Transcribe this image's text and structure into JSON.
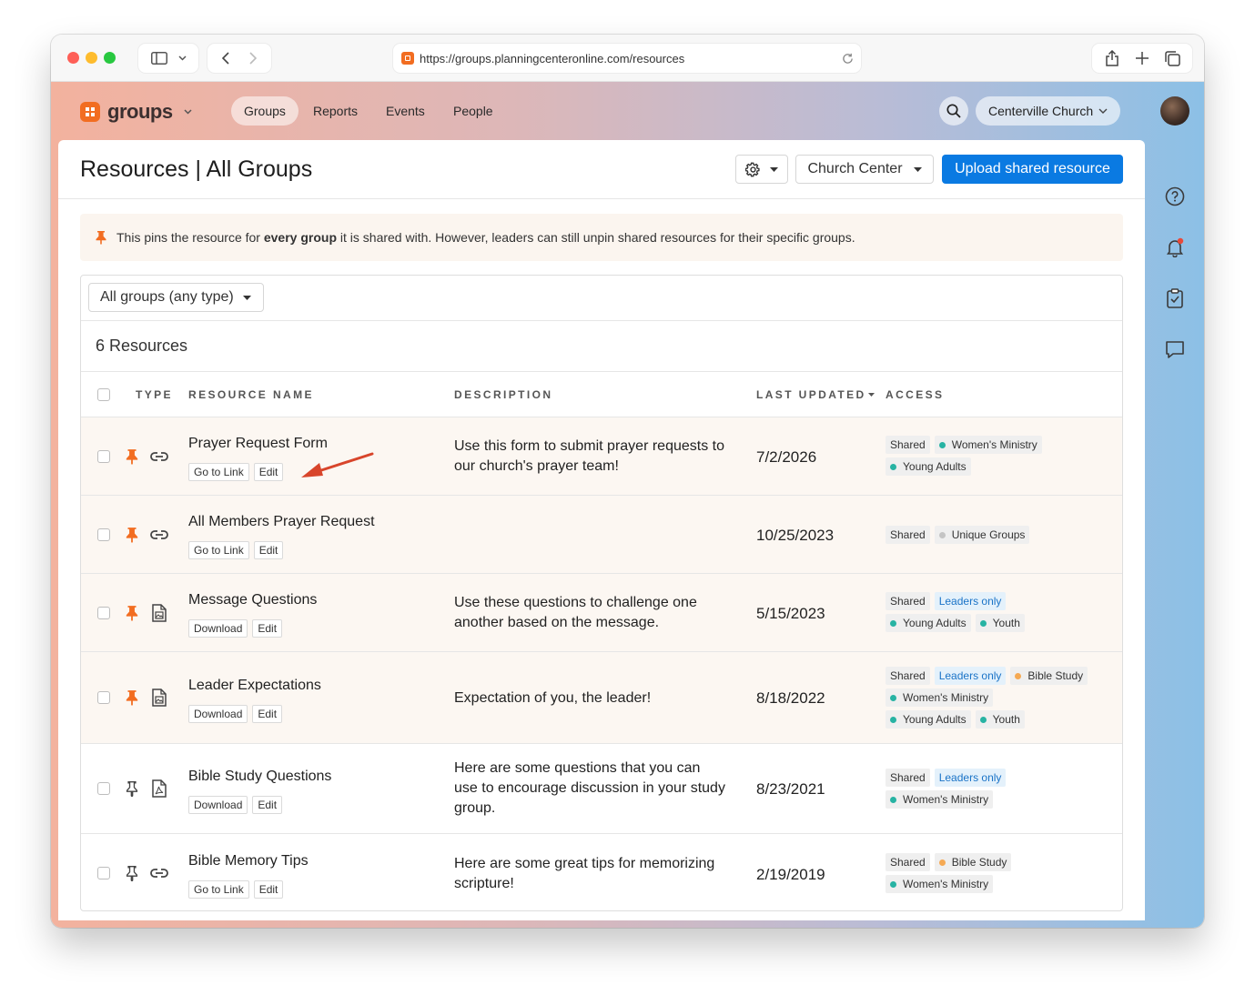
{
  "browser": {
    "url": "https://groups.planningcenteronline.com/resources"
  },
  "nav": {
    "app_name": "groups",
    "tabs": [
      {
        "label": "Groups",
        "active": true
      },
      {
        "label": "Reports",
        "active": false
      },
      {
        "label": "Events",
        "active": false
      },
      {
        "label": "People",
        "active": false
      }
    ],
    "org_name": "Centerville Church"
  },
  "page": {
    "title": "Resources | All Groups",
    "church_center_label": "Church Center",
    "upload_label": "Upload shared resource"
  },
  "notice": {
    "prefix": "This pins the resource for ",
    "bold": "every group",
    "suffix": " it is shared with. However, leaders can still unpin shared resources for their specific groups."
  },
  "filter": {
    "selected": "All groups (any type)"
  },
  "resource_count": "6 Resources",
  "columns": {
    "type": "TYPE",
    "name": "RESOURCE NAME",
    "description": "DESCRIPTION",
    "updated": "LAST UPDATED",
    "access": "ACCESS"
  },
  "colors": {
    "accent": "#0a7ae2",
    "pin_active": "#f26d21",
    "dot_teal": "#27b3a3",
    "dot_orange": "#f5a953",
    "dot_gray": "#c4c4c4"
  },
  "resources": [
    {
      "name": "Prayer Request Form",
      "type_icon": "link-icon",
      "pinned": true,
      "actions": [
        "Go to Link",
        "Edit"
      ],
      "description": "Use this form to submit prayer requests to our church's prayer team!",
      "updated": "7/2/2026",
      "access_lines": [
        [
          {
            "label": "Shared",
            "kind": "plain"
          },
          {
            "label": "Women's Ministry",
            "kind": "dot",
            "dot": "teal"
          }
        ],
        [
          {
            "label": "Young Adults",
            "kind": "dot",
            "dot": "teal"
          }
        ]
      ]
    },
    {
      "name": "All Members Prayer Request",
      "type_icon": "link-icon",
      "pinned": true,
      "actions": [
        "Go to Link",
        "Edit"
      ],
      "description": "",
      "updated": "10/25/2023",
      "access_lines": [
        [
          {
            "label": "Shared",
            "kind": "plain"
          },
          {
            "label": "Unique Groups",
            "kind": "dot",
            "dot": "gray"
          }
        ]
      ]
    },
    {
      "name": "Message Questions",
      "type_icon": "image-file-icon",
      "pinned": true,
      "actions": [
        "Download",
        "Edit"
      ],
      "description": "Use these questions to challenge one another based on the message.",
      "updated": "5/15/2023",
      "access_lines": [
        [
          {
            "label": "Shared",
            "kind": "plain"
          },
          {
            "label": "Leaders only",
            "kind": "blue"
          }
        ],
        [
          {
            "label": "Young Adults",
            "kind": "dot",
            "dot": "teal"
          },
          {
            "label": "Youth",
            "kind": "dot",
            "dot": "teal"
          }
        ]
      ]
    },
    {
      "name": "Leader Expectations",
      "type_icon": "image-file-icon",
      "pinned": true,
      "actions": [
        "Download",
        "Edit"
      ],
      "description": "Expectation of you, the leader!",
      "updated": "8/18/2022",
      "access_lines": [
        [
          {
            "label": "Shared",
            "kind": "plain"
          },
          {
            "label": "Leaders only",
            "kind": "blue"
          },
          {
            "label": "Bible Study",
            "kind": "dot",
            "dot": "orange"
          }
        ],
        [
          {
            "label": "Women's Ministry",
            "kind": "dot",
            "dot": "teal"
          }
        ],
        [
          {
            "label": "Young Adults",
            "kind": "dot",
            "dot": "teal"
          },
          {
            "label": "Youth",
            "kind": "dot",
            "dot": "teal"
          }
        ]
      ]
    },
    {
      "name": "Bible Study Questions",
      "type_icon": "pdf-file-icon",
      "pinned": false,
      "actions": [
        "Download",
        "Edit"
      ],
      "description": "Here are some questions that you can use to encourage discussion in your study group.",
      "updated": "8/23/2021",
      "access_lines": [
        [
          {
            "label": "Shared",
            "kind": "plain"
          },
          {
            "label": "Leaders only",
            "kind": "blue"
          }
        ],
        [
          {
            "label": "Women's Ministry",
            "kind": "dot",
            "dot": "teal"
          }
        ]
      ]
    },
    {
      "name": "Bible Memory Tips",
      "type_icon": "link-icon",
      "pinned": false,
      "actions": [
        "Go to Link",
        "Edit"
      ],
      "description": "Here are some great tips for memorizing scripture!",
      "updated": "2/19/2019",
      "access_lines": [
        [
          {
            "label": "Shared",
            "kind": "plain"
          },
          {
            "label": "Bible Study",
            "kind": "dot",
            "dot": "orange"
          }
        ],
        [
          {
            "label": "Women's Ministry",
            "kind": "dot",
            "dot": "teal"
          }
        ]
      ]
    }
  ]
}
